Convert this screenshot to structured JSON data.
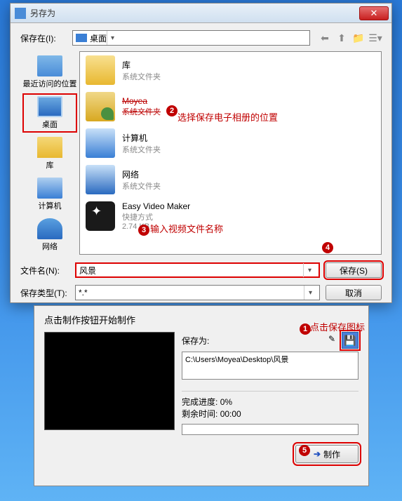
{
  "dialog": {
    "title": "另存为",
    "close": "✕",
    "lookin_label": "保存在(I):",
    "lookin_value": "桌面",
    "places": [
      {
        "label": "最近访问的位置"
      },
      {
        "label": "桌面"
      },
      {
        "label": "库"
      },
      {
        "label": "计算机"
      },
      {
        "label": "网络"
      }
    ],
    "files": [
      {
        "name": "库",
        "sub": "系统文件夹"
      },
      {
        "name": "Moyea",
        "sub": "系统文件夹"
      },
      {
        "name": "计算机",
        "sub": "系统文件夹"
      },
      {
        "name": "网络",
        "sub": "系统文件夹"
      },
      {
        "name": "Easy Video Maker",
        "sub": "快捷方式",
        "size": "2.74 KB"
      }
    ],
    "filename_label": "文件名(N):",
    "filename_value": "风景",
    "filetype_label": "保存类型(T):",
    "filetype_value": "*.*",
    "save_btn": "保存(S)",
    "cancel_btn": "取消"
  },
  "panel": {
    "title": "点击制作按钮开始制作",
    "save_as_label": "保存为:",
    "path": "C:\\Users\\Moyea\\Desktop\\风景",
    "progress_label": "完成进度:",
    "progress_value": "0%",
    "remain_label": "剩余时间:",
    "remain_value": "00:00",
    "make_btn": "制作"
  },
  "annotations": {
    "a1": "点击保存图标",
    "a2": "选择保存电子相册的位置",
    "a3": "输入视频文件名称"
  }
}
